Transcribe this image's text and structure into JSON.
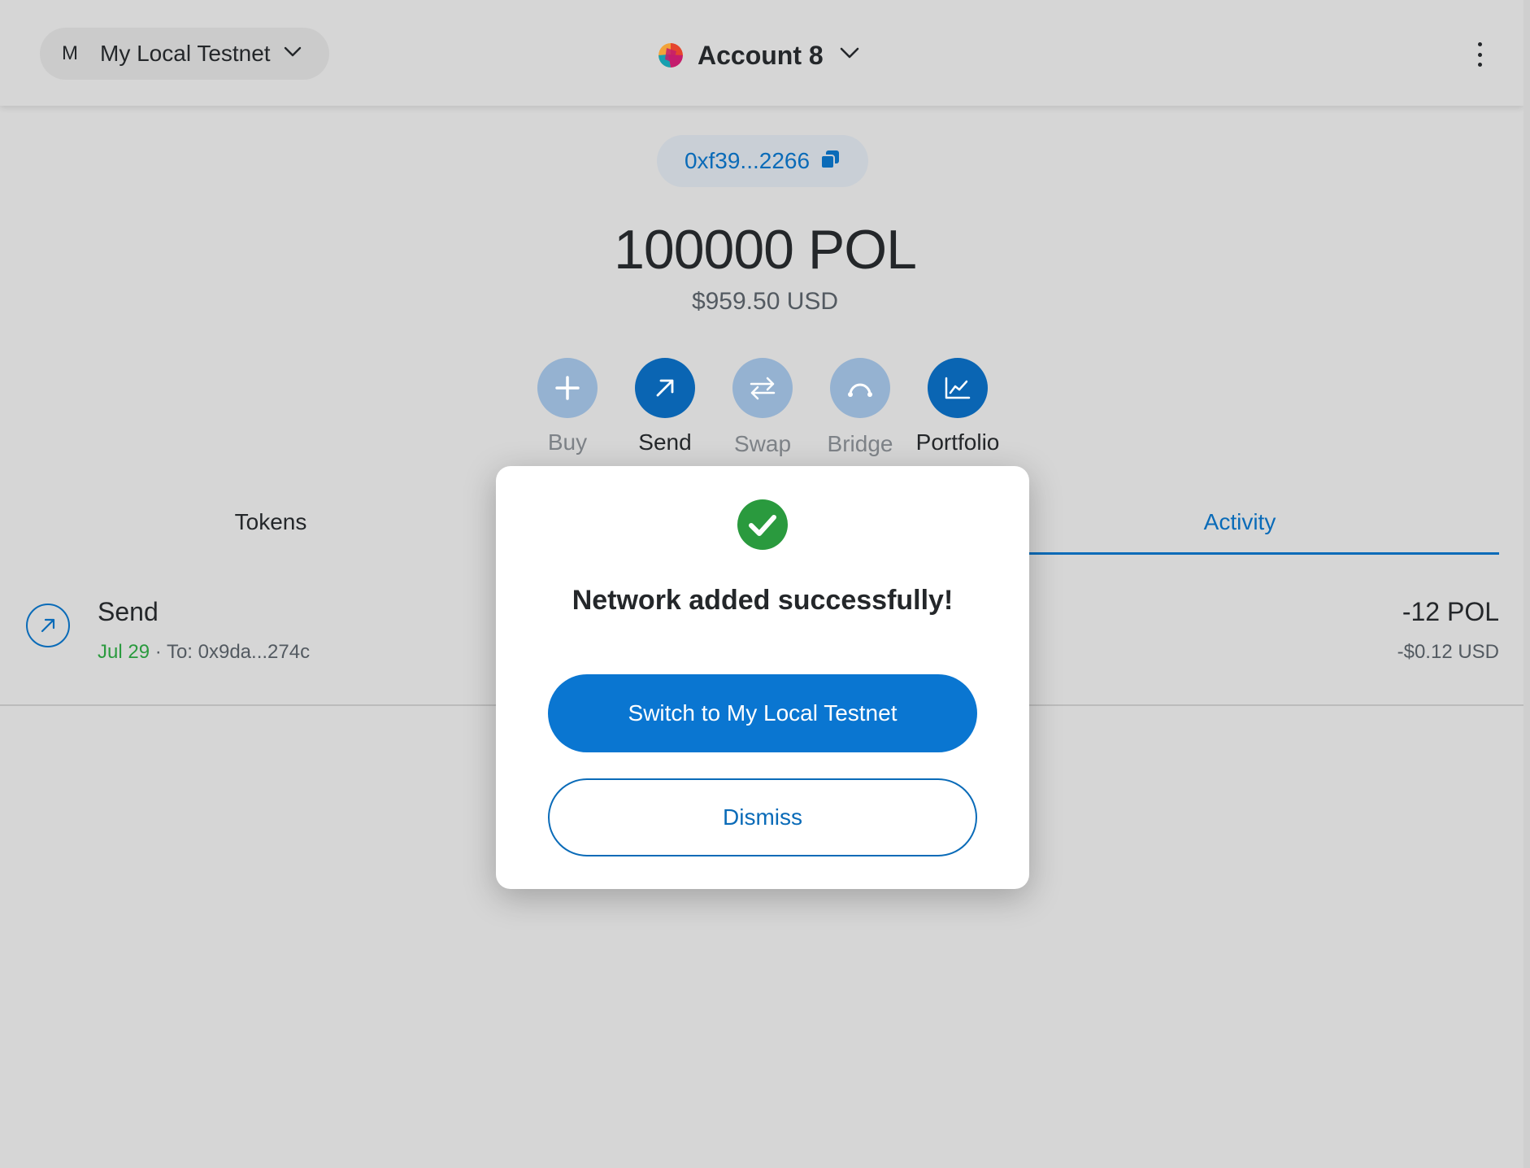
{
  "header": {
    "network": {
      "avatar_letter": "M",
      "name": "My Local Testnet"
    },
    "account": {
      "name": "Account 8"
    },
    "menu_icon": "kebab-menu-icon"
  },
  "wallet": {
    "address": "0xf39...2266",
    "balance": "100000 POL",
    "fiat_balance": "$959.50 USD"
  },
  "actions": [
    {
      "label": "Buy",
      "icon": "plus-icon",
      "enabled": false
    },
    {
      "label": "Send",
      "icon": "arrow-up-right-icon",
      "enabled": true
    },
    {
      "label": "Swap",
      "icon": "swap-arrows-icon",
      "enabled": false
    },
    {
      "label": "Bridge",
      "icon": "bridge-icon",
      "enabled": false
    },
    {
      "label": "Portfolio",
      "icon": "chart-icon",
      "enabled": true
    }
  ],
  "tabs": [
    {
      "label": "Tokens",
      "active": false
    },
    {
      "label": "Activity",
      "active": true
    }
  ],
  "activity": [
    {
      "title": "Send",
      "date": "Jul 29",
      "separator": "·",
      "recipient": "To: 0x9da...274c",
      "amount": "-12 POL",
      "fiat": "-$0.12 USD"
    }
  ],
  "modal": {
    "title": "Network added successfully!",
    "primary_button": "Switch to My Local Testnet",
    "secondary_button": "Dismiss"
  },
  "colors": {
    "accent": "#0a6bb8",
    "primary_button": "#0a76d1",
    "success": "#2a9a3e",
    "overlay_bg": "#d6d6d6"
  }
}
